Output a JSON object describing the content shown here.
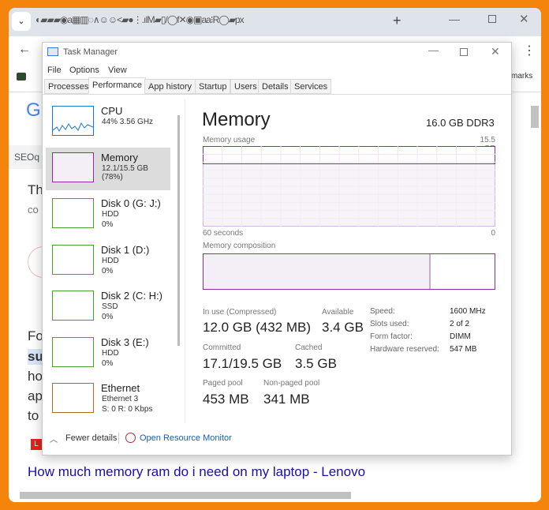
{
  "browser": {
    "tab_icons": "◐▰▰▰◉a▦▥◌∧☺☺<▰●⋮.ıIM▰▯/◯f✕◉▣aa⁝R◯▰px",
    "new_tab": "+",
    "bookmarks_tail": "marks",
    "site_letter": "G",
    "seo_label": "SEOq",
    "lines": [
      "Th",
      "co",
      "Fo",
      "su",
      "ho",
      "ap",
      "to"
    ],
    "result_link": "How much memory ram do i need on my laptop - Lenovo",
    "lenovo_badge": "L"
  },
  "tm": {
    "title": "Task Manager",
    "menu": [
      "File",
      "Options",
      "View"
    ],
    "tabs": [
      "Processes",
      "Performance",
      "App history",
      "Startup",
      "Users",
      "Details",
      "Services"
    ],
    "active_tab": "Performance",
    "sidebar": [
      {
        "name": "CPU",
        "sub1": "44% 3.56 GHz",
        "sub2": "",
        "sub3": "",
        "color": "#1a7ac4"
      },
      {
        "name": "Memory",
        "sub1": "12.1/15.5 GB (78%)",
        "sub2": "",
        "sub3": "",
        "color": "#8b2fa0"
      },
      {
        "name": "Disk 0 (G: J:)",
        "sub1": "HDD",
        "sub2": "0%",
        "sub3": "",
        "color": "#4aa02c"
      },
      {
        "name": "Disk 1 (D:)",
        "sub1": "HDD",
        "sub2": "0%",
        "sub3": "",
        "color": "#4aa02c"
      },
      {
        "name": "Disk 2 (C: H:)",
        "sub1": "SSD",
        "sub2": "0%",
        "sub3": "",
        "color": "#4aa02c"
      },
      {
        "name": "Disk 3 (E:)",
        "sub1": "HDD",
        "sub2": "0%",
        "sub3": "",
        "color": "#4aa02c"
      },
      {
        "name": "Ethernet",
        "sub1": "Ethernet 3",
        "sub2": "S: 0 R: 0 Kbps",
        "sub3": "",
        "color": "#a76e2a"
      }
    ],
    "main": {
      "title": "Memory",
      "capacity": "16.0 GB DDR3",
      "usage_label": "Memory usage",
      "usage_max": "15.5 GB",
      "time_left": "60 seconds",
      "time_right": "0",
      "composition_label": "Memory composition",
      "in_use_fraction": 0.78,
      "stats": {
        "in_use_label": "In use (Compressed)",
        "in_use": "12.0 GB (432 MB)",
        "available_label": "Available",
        "available": "3.4 GB",
        "committed_label": "Committed",
        "committed": "17.1/19.5 GB",
        "cached_label": "Cached",
        "cached": "3.5 GB",
        "paged_label": "Paged pool",
        "paged": "453 MB",
        "nonpaged_label": "Non-paged pool",
        "nonpaged": "341 MB"
      },
      "specs": [
        {
          "k": "Speed:",
          "v": "1600 MHz"
        },
        {
          "k": "Slots used:",
          "v": "2 of 2"
        },
        {
          "k": "Form factor:",
          "v": "DIMM"
        },
        {
          "k": "Hardware reserved:",
          "v": "547 MB"
        }
      ]
    },
    "footer": {
      "fewer": "Fewer details",
      "monitor": "Open Resource Monitor"
    }
  }
}
